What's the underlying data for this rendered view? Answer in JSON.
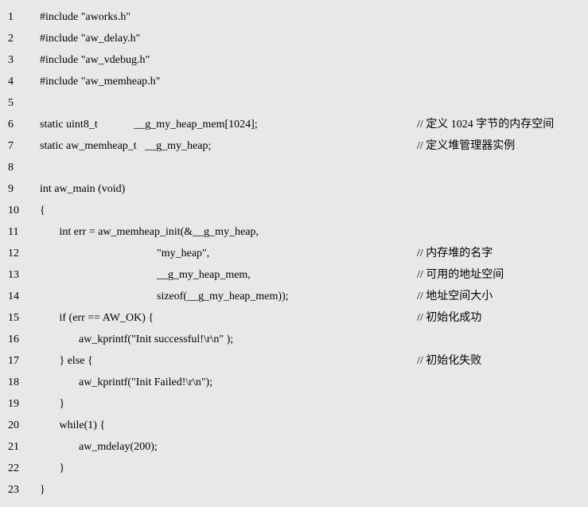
{
  "lines": [
    {
      "n": "1",
      "code": "#include \"aworks.h\"",
      "comment": ""
    },
    {
      "n": "2",
      "code": "#include \"aw_delay.h\"",
      "comment": ""
    },
    {
      "n": "3",
      "code": "#include \"aw_vdebug.h\"",
      "comment": ""
    },
    {
      "n": "4",
      "code": "#include \"aw_memheap.h\"",
      "comment": ""
    },
    {
      "n": "5",
      "code": "",
      "comment": ""
    },
    {
      "n": "6",
      "code": "static uint8_t             __g_my_heap_mem[1024];",
      "comment": "// 定义 1024 字节的内存空间"
    },
    {
      "n": "7",
      "code": "static aw_memheap_t   __g_my_heap;",
      "comment": "// 定义堆管理器实例"
    },
    {
      "n": "8",
      "code": "",
      "comment": ""
    },
    {
      "n": "9",
      "code": "int aw_main (void)",
      "comment": ""
    },
    {
      "n": "10",
      "code": "{",
      "comment": ""
    },
    {
      "n": "11",
      "code": "       int err = aw_memheap_init(&__g_my_heap,",
      "comment": ""
    },
    {
      "n": "12",
      "code": "                                          \"my_heap\",",
      "comment": "// 内存堆的名字"
    },
    {
      "n": "13",
      "code": "                                          __g_my_heap_mem,",
      "comment": "// 可用的地址空间"
    },
    {
      "n": "14",
      "code": "                                          sizeof(__g_my_heap_mem));",
      "comment": "// 地址空间大小"
    },
    {
      "n": "15",
      "code": "       if (err == AW_OK) {",
      "comment": "// 初始化成功"
    },
    {
      "n": "16",
      "code": "              aw_kprintf(\"Init successful!\\r\\n\" );",
      "comment": ""
    },
    {
      "n": "17",
      "code": "       } else {",
      "comment": "// 初始化失败"
    },
    {
      "n": "18",
      "code": "              aw_kprintf(\"Init Failed!\\r\\n\");",
      "comment": ""
    },
    {
      "n": "19",
      "code": "       }",
      "comment": ""
    },
    {
      "n": "20",
      "code": "       while(1) {",
      "comment": ""
    },
    {
      "n": "21",
      "code": "              aw_mdelay(200);",
      "comment": ""
    },
    {
      "n": "22",
      "code": "       }",
      "comment": ""
    },
    {
      "n": "23",
      "code": "}",
      "comment": ""
    }
  ]
}
